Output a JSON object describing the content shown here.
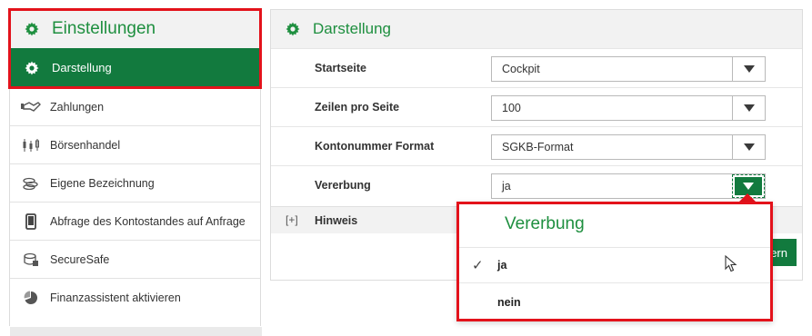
{
  "sidebar": {
    "title": "Einstellungen",
    "active_item": {
      "label": "Darstellung",
      "icon": "gear-icon"
    },
    "items": [
      {
        "label": "Zahlungen",
        "icon": "handshake-icon"
      },
      {
        "label": "Börsenhandel",
        "icon": "candlestick-icon"
      },
      {
        "label": "Eigene Bezeichnung",
        "icon": "coins-icon"
      },
      {
        "label": "Abfrage des Kontostandes auf Anfrage",
        "icon": "phone-icon"
      },
      {
        "label": "SecureSafe",
        "icon": "safe-icon"
      },
      {
        "label": "Finanzassistent aktivieren",
        "icon": "pie-chart-icon"
      }
    ]
  },
  "main": {
    "title": "Darstellung",
    "rows": [
      {
        "label": "Startseite",
        "value": "Cockpit"
      },
      {
        "label": "Zeilen pro Seite",
        "value": "100"
      },
      {
        "label": "Kontonummer Format",
        "value": "SGKB-Format"
      },
      {
        "label": "Vererbung",
        "value": "ja"
      }
    ],
    "hint": {
      "toggle": "[+]",
      "label": "Hinweis"
    },
    "save_button_partial": "ern"
  },
  "dropdown": {
    "title": "Vererbung",
    "options": [
      {
        "label": "ja",
        "selected": true
      },
      {
        "label": "nein",
        "selected": false
      }
    ]
  },
  "colors": {
    "accent_green": "#127a3e",
    "title_green": "#1e8f3f",
    "highlight_red": "#e3121b"
  }
}
